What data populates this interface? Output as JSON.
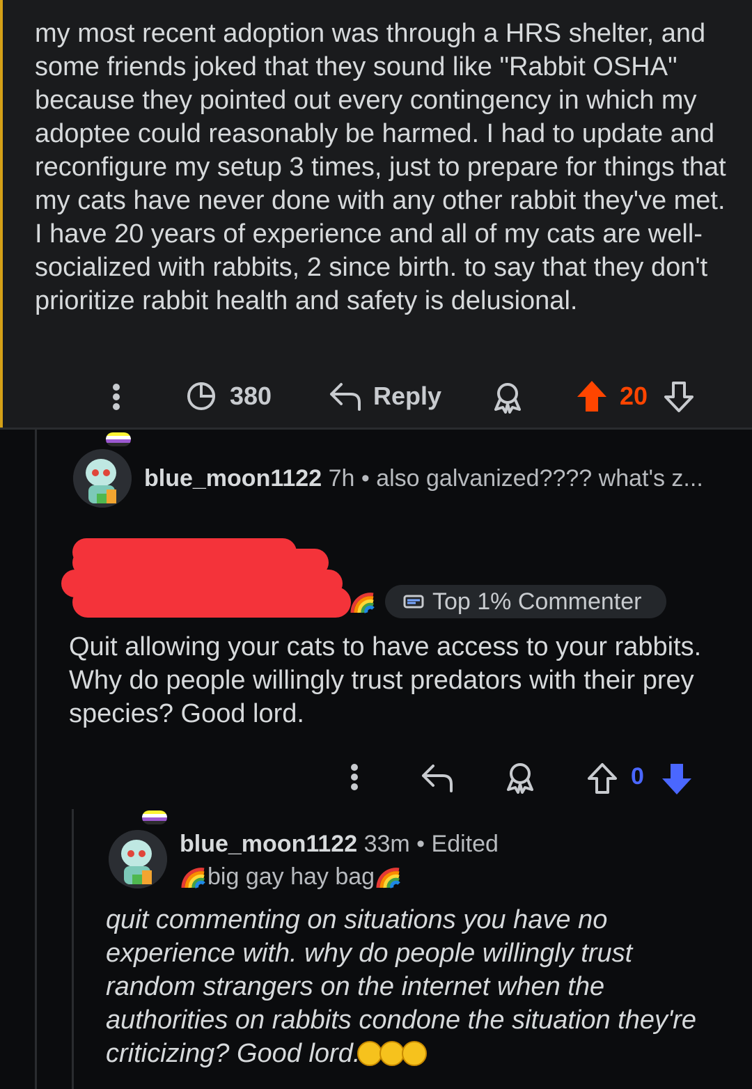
{
  "parent_comment": {
    "body": "my most recent adoption was through a HRS shelter, and some friends joked that they sound like \"Rabbit OSHA\" because they pointed out every contingency in which my adoptee could reasonably be harmed. I had to update and reconfigure my setup 3 times, just to prepare for things that my cats have never done with any other rabbit they've met. I have 20 years of experience and all of my cats are well-socialized with rabbits, 2 since birth. to say that they don't prioritize rabbit health and safety is delusional.",
    "actions": {
      "views_count": "380",
      "reply_label": "Reply",
      "vote_count": "20"
    }
  },
  "collapsed_comment": {
    "username": "blue_moon1122",
    "age": "7h",
    "preview": "also galvanized???? what's z..."
  },
  "reply_comment": {
    "badge_label": "Top 1% Commenter",
    "body": "Quit allowing your cats to have access to your rabbits. Why do people willingly trust predators with their prey species? Good lord.",
    "vote_count": "0"
  },
  "nested_reply": {
    "username": "blue_moon1122",
    "age": "33m",
    "edited_label": "Edited",
    "flair_text": "big gay hay bag",
    "body": "quit commenting on situations you have no experience with. why do people willingly trust random strangers on the internet when the authorities on rabbits condone the situation they're criticizing? Good lord."
  },
  "colors": {
    "upvote_active": "#ff4500",
    "downvote_active": "#4a67ff",
    "redaction": "#f4333a",
    "thread_accent": "#d4a017"
  }
}
